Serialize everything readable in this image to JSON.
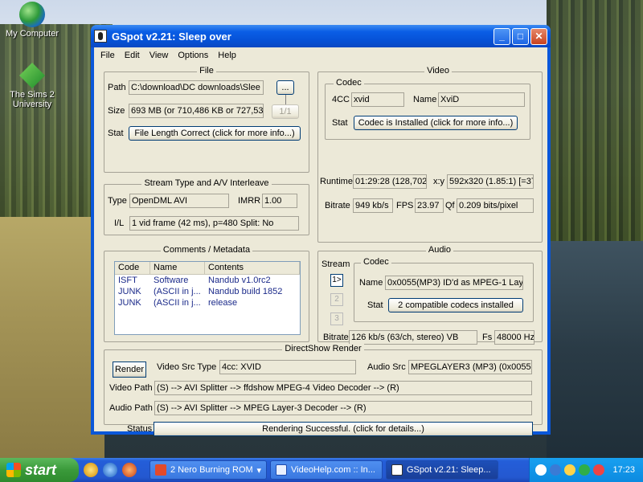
{
  "desktop": {
    "icons": [
      {
        "label": "My Computer"
      },
      {
        "label": "The Sims 2 University"
      }
    ]
  },
  "window": {
    "title": "GSpot v2.21: Sleep over",
    "menu": [
      "File",
      "Edit",
      "View",
      "Options",
      "Help"
    ]
  },
  "file": {
    "legend": "File",
    "path_label": "Path",
    "path_value": "C:\\download\\DC downloads\\Slee",
    "browse_label": "...",
    "size_label": "Size",
    "size_value": "693 MB (or 710,486 KB or 727,53",
    "part_label": "1/1",
    "stat_label": "Stat",
    "stat_button": "File Length Correct (click for more info...)"
  },
  "stream": {
    "legend": "Stream Type and A/V Interleave",
    "type_label": "Type",
    "type_value": "OpenDML AVI",
    "imrr_label": "IMRR",
    "imrr_value": "1.00",
    "il_label": "I/L",
    "il_value": "1 vid frame (42 ms), p=480  Split: No"
  },
  "comments": {
    "legend": "Comments / Metadata",
    "headers": [
      "Code",
      "Name",
      "Contents"
    ],
    "rows": [
      {
        "code": "ISFT",
        "name": "Software",
        "contents": "Nandub v1.0rc2"
      },
      {
        "code": "JUNK",
        "name": "(ASCII in j...",
        "contents": "Nandub build 1852"
      },
      {
        "code": "JUNK",
        "name": "(ASCII in j...",
        "contents": "release"
      }
    ]
  },
  "video": {
    "legend": "Video",
    "codec_legend": "Codec",
    "fourcc_label": "4CC",
    "fourcc_value": "xvid",
    "name_label": "Name",
    "name_value": "XviD",
    "stat_label": "Stat",
    "stat_button": "Codec is Installed (click for more info...)",
    "runtime_label": "Runtime",
    "runtime_value": "01:29:28 (128,702",
    "xy_label": "x:y",
    "xy_value": "592x320 (1.85:1) [=37",
    "bitrate_label": "Bitrate",
    "bitrate_value": "949 kb/s",
    "fps_label": "FPS",
    "fps_value": "23.97",
    "qf_label": "Qf",
    "qf_value": "0.209 bits/pixel"
  },
  "audio": {
    "legend": "Audio",
    "stream_label": "Stream",
    "stream_buttons": [
      "1>",
      "2",
      "3"
    ],
    "codec_legend": "Codec",
    "name_label": "Name",
    "name_value": "0x0055(MP3) ID'd as MPEG-1 Lay",
    "stat_label": "Stat",
    "stat_button": "2 compatible codecs installed",
    "bitrate_label": "Bitrate",
    "bitrate_value": "126 kb/s (63/ch, stereo) VB",
    "fs_label": "Fs",
    "fs_value": "48000 Hz"
  },
  "directshow": {
    "legend": "DirectShow Render",
    "render_button": "Render",
    "video_src_label": "Video Src Type",
    "video_src_value": "4cc: XVID",
    "audio_src_label": "Audio Src",
    "audio_src_value": "MPEGLAYER3 (MP3) (0x0055)",
    "video_path_label": "Video Path",
    "video_path_value": "(S) --> AVI Splitter --> ffdshow MPEG-4 Video Decoder --> (R)",
    "audio_path_label": "Audio Path",
    "audio_path_value": "(S) --> AVI Splitter --> MPEG Layer-3 Decoder --> (R)",
    "status_label": "Status",
    "status_value": "Rendering Successful.  (click for details...)"
  },
  "taskbar": {
    "start_label": "start",
    "tasks": [
      {
        "label": "2 Nero Burning ROM",
        "icon_color": "#e24a2a"
      },
      {
        "label": "VideoHelp.com :: In...",
        "icon_color": "#e9f0ff"
      },
      {
        "label": "GSpot v2.21: Sleep...",
        "icon_color": "#ffffff"
      }
    ],
    "clock": "17:23"
  }
}
